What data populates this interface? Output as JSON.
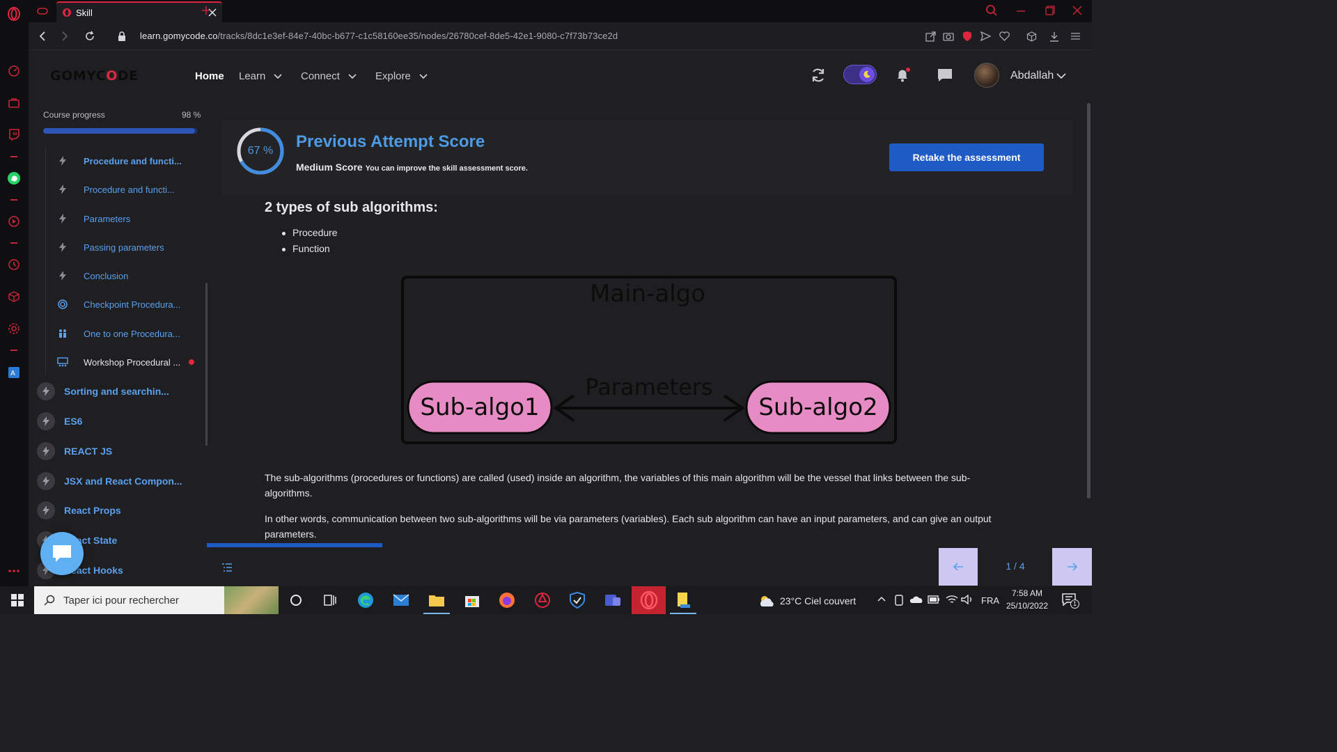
{
  "browser": {
    "tab_title": "Skill",
    "url_host": "learn.gomycode.co",
    "url_path": "/tracks/8dc1e3ef-84e7-40bc-b677-c1c58160ee35/nodes/26780cef-8de5-42e1-9080-c7f73b73ce2d"
  },
  "header": {
    "logo_left": "GOMYC",
    "logo_mid": "O",
    "logo_right": "DE",
    "nav": [
      {
        "label": "Home"
      },
      {
        "label": "Learn"
      },
      {
        "label": "Connect"
      },
      {
        "label": "Explore"
      }
    ],
    "username": "Abdallah",
    "theme_toggle_on": true,
    "accent": "#4d9be6"
  },
  "sidebar": {
    "progress_label": "Course progress",
    "progress_value": "98 %",
    "progress_fraction": 0.98,
    "sub_items": [
      {
        "label": "Procedure and functi...",
        "icon": "bolt-icon",
        "bold": true
      },
      {
        "label": "Procedure and functi...",
        "icon": "bolt-icon"
      },
      {
        "label": "Parameters",
        "icon": "bolt-icon"
      },
      {
        "label": "Passing parameters",
        "icon": "bolt-icon"
      },
      {
        "label": "Conclusion",
        "icon": "bolt-icon"
      },
      {
        "label": "Checkpoint Procedura...",
        "icon": "target-icon"
      },
      {
        "label": "One to one Procedura...",
        "icon": "people-icon"
      },
      {
        "label": "Workshop Procedural ...",
        "icon": "workshop-icon",
        "dot": true
      }
    ],
    "sections": [
      {
        "label": "Sorting and searchin..."
      },
      {
        "label": "ES6"
      },
      {
        "label": "REACT JS"
      },
      {
        "label": "JSX and React Compon..."
      },
      {
        "label": "React Props"
      },
      {
        "label": "React State"
      },
      {
        "label": "React Hooks"
      }
    ]
  },
  "score": {
    "percent_text": "67 %",
    "percent": 67,
    "title": "Previous Attempt Score",
    "level": "Medium Score",
    "hint": "You can improve the skill assessment score.",
    "retake_label": "Retake the assessment"
  },
  "lesson": {
    "heading": "2 types of sub algorithms:",
    "bullets": [
      "Procedure",
      "Function"
    ],
    "diagram": {
      "main_label": "Main-algo",
      "left_label": "Sub-algo1",
      "right_label": "Sub-algo2",
      "arrow_label": "Parameters",
      "pill_color": "#e78bc4"
    },
    "paragraph_1": "The sub-algorithms (procedures or functions) are called (used) inside an algorithm, the variables of this main algorithm will be the vessel that links between the sub-algorithms.",
    "paragraph_2": "In other words, communication between two sub-algorithms will be via parameters (variables). Each sub algorithm can have an input parameters, and can give an output parameters."
  },
  "pager": {
    "indicator": "1 / 4",
    "progress_fraction": 0.2
  },
  "taskbar": {
    "search_placeholder": "Taper ici pour rechercher",
    "weather": "23°C  Ciel couvert",
    "language": "FRA",
    "time": "7:58 AM",
    "date": "25/10/2022",
    "notifications": "1"
  }
}
